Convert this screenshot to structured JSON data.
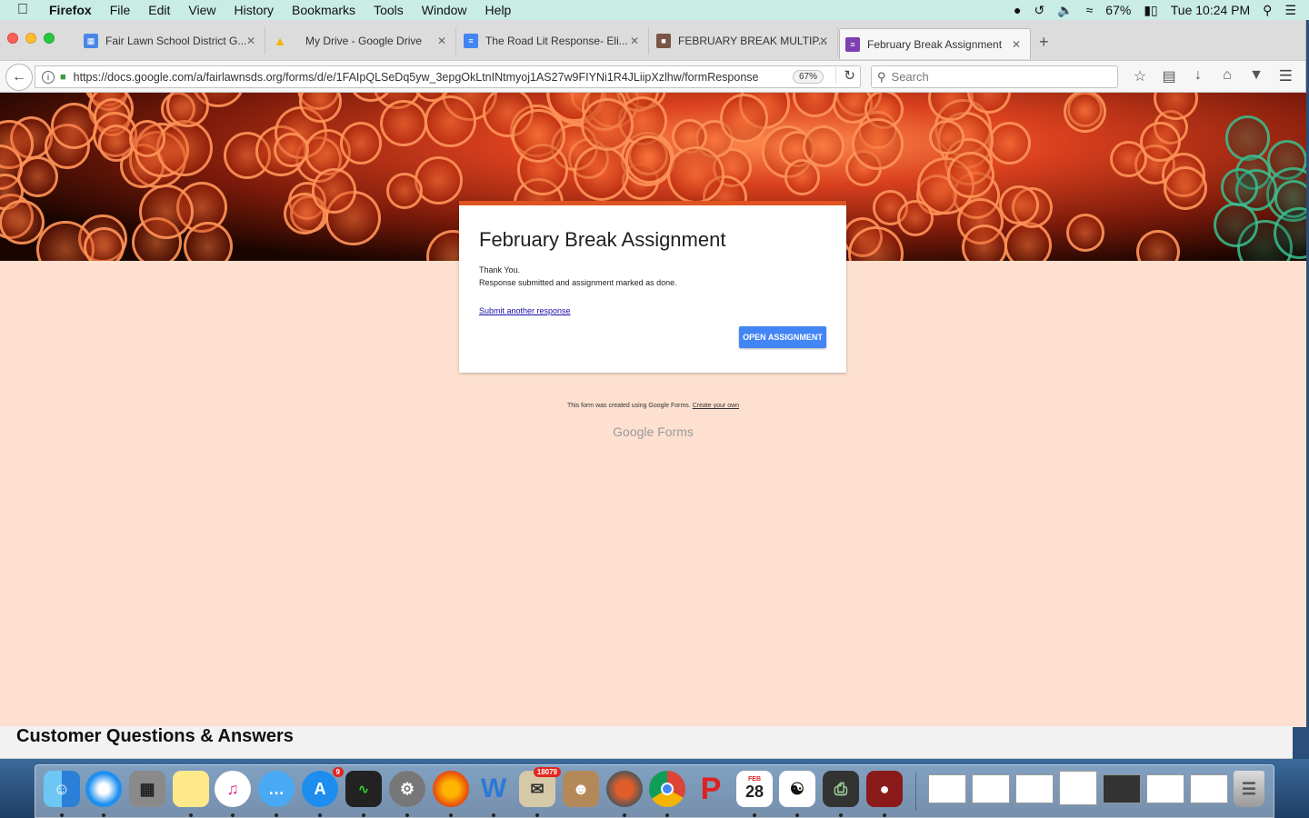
{
  "menubar": {
    "app": "Firefox",
    "items": [
      "File",
      "Edit",
      "View",
      "History",
      "Bookmarks",
      "Tools",
      "Window",
      "Help"
    ],
    "battery": "67%",
    "clock": "Tue 10:24 PM"
  },
  "tabs": [
    {
      "title": "Fair Lawn School District G...",
      "icon": "classroom-icon",
      "color": "#4a86e8"
    },
    {
      "title": "My Drive - Google Drive",
      "icon": "drive-icon",
      "color": "#f4b400"
    },
    {
      "title": "The Road Lit Response- Eli...",
      "icon": "docs-icon",
      "color": "#4285f4"
    },
    {
      "title": "FEBRUARY BREAK MULTIP...",
      "icon": "classroom-assignment-icon",
      "color": "#795548"
    },
    {
      "title": "February Break Assignment",
      "icon": "forms-icon",
      "color": "#7e3fb2"
    }
  ],
  "navbar": {
    "url": "https://docs.google.com/a/fairlawnsds.org/forms/d/e/1FAIpQLSeDq5yw_3epgOkLtnINtmyoj1AS27w9FIYNi1R4JLiipXzlhw/formResponse",
    "zoom": "67%",
    "search_placeholder": "Search"
  },
  "form": {
    "title": "February Break Assignment",
    "thank_you": "Thank You.",
    "confirmation": "Response submitted and assignment marked as done.",
    "submit_another": "Submit another response",
    "open_button": "OPEN ASSIGNMENT",
    "accent": "#e0531f",
    "button_color": "#4285f4"
  },
  "footer": {
    "note": "This form was created using Google Forms.",
    "create_link": "Create your own",
    "brand_google": "Google",
    "brand_forms": "Forms"
  },
  "behind_window": {
    "heading": "Customer Questions & Answers"
  },
  "dock": {
    "appstore_badge": "9",
    "mail_badge": "18079",
    "calendar_month": "FEB",
    "calendar_day": "28"
  }
}
